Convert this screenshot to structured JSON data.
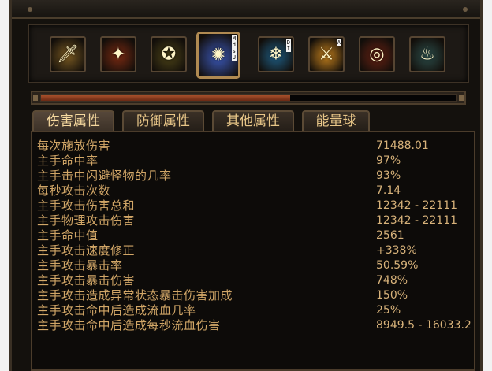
{
  "skills": [
    {
      "name": "sword-skill-icon",
      "glyph": "🗡",
      "bg": "#7a5a22",
      "badge": ""
    },
    {
      "name": "fire-blast-skill-icon",
      "glyph": "✦",
      "bg": "#7a2a12",
      "badge": ""
    },
    {
      "name": "rune-circle-skill-icon",
      "glyph": "✪",
      "bg": "#4d4418",
      "badge": ""
    },
    {
      "name": "lightning-orb-skill-icon",
      "glyph": "✺",
      "bg": "#3b58b8",
      "badge": "M\nd\ns\nU"
    },
    {
      "name": "ice-shards-skill-icon",
      "glyph": "❄",
      "bg": "#1f5f86",
      "badge": "D\nI"
    },
    {
      "name": "warrior-leap-skill-icon",
      "glyph": "⚔",
      "bg": "#c6821e",
      "badge": "A"
    },
    {
      "name": "dragon-ring-skill-icon",
      "glyph": "◎",
      "bg": "#6b2314",
      "badge": ""
    },
    {
      "name": "blood-aura-skill-icon",
      "glyph": "♨",
      "bg": "#2c4d4a",
      "badge": ""
    }
  ],
  "progress": {
    "fill_fraction": 0.6
  },
  "tabs": [
    {
      "label": "伤害属性"
    },
    {
      "label": "防御属性"
    },
    {
      "label": "其他属性"
    },
    {
      "label": "能量球"
    }
  ],
  "stats": [
    {
      "label": "每次施放伤害",
      "value": "71488.01"
    },
    {
      "label": "主手命中率",
      "value": "97%"
    },
    {
      "label": "主手击中闪避怪物的几率",
      "value": "93%"
    },
    {
      "label": "每秒攻击次数",
      "value": "7.14"
    },
    {
      "label": "主手攻击伤害总和",
      "value": "12342 - 22111"
    },
    {
      "label": "主手物理攻击伤害",
      "value": "12342 - 22111"
    },
    {
      "label": "主手命中值",
      "value": "2561"
    },
    {
      "label": "主手攻击速度修正",
      "value": "+338%"
    },
    {
      "label": "主手攻击暴击率",
      "value": "50.59%"
    },
    {
      "label": "主手攻击暴击伤害",
      "value": "748%"
    },
    {
      "label": "主手攻击造成异常状态暴击伤害加成",
      "value": "150%"
    },
    {
      "label": "主手攻击命中后造成流血几率",
      "value": "25%"
    },
    {
      "label": "主手攻击命中后造成每秒流血伤害",
      "value": "8949.5 - 16033.2"
    }
  ]
}
